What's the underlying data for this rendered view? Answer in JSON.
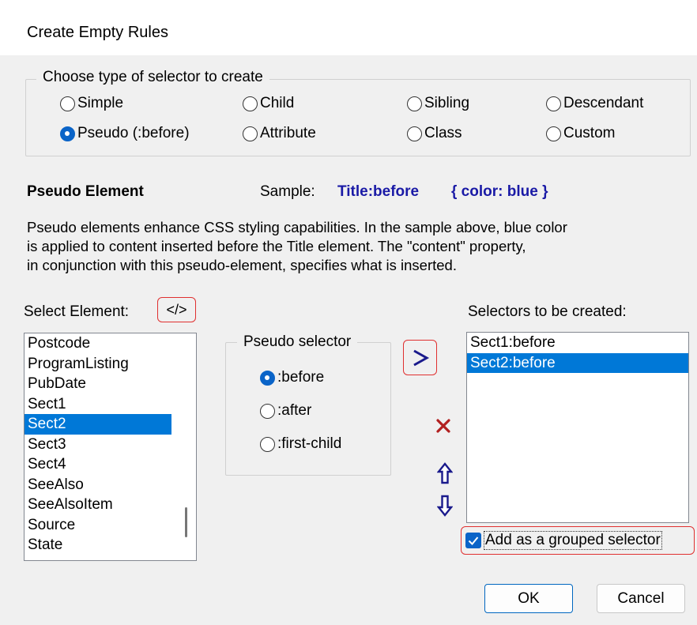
{
  "window": {
    "title": "Create Empty Rules"
  },
  "selector_type": {
    "legend": "Choose type of selector to create",
    "options": [
      {
        "label": "Simple",
        "checked": false
      },
      {
        "label": "Child",
        "checked": false
      },
      {
        "label": "Sibling",
        "checked": false
      },
      {
        "label": "Descendant",
        "checked": false
      },
      {
        "label": "Pseudo (:before)",
        "checked": true
      },
      {
        "label": "Attribute",
        "checked": false
      },
      {
        "label": "Class",
        "checked": false
      },
      {
        "label": "Custom",
        "checked": false
      }
    ]
  },
  "info": {
    "heading": "Pseudo Element",
    "sample_label": "Sample:",
    "sample_selector": "Title:before",
    "sample_rule": "{ color: blue }",
    "description_lines": [
      "Pseudo elements enhance CSS styling capabilities. In the sample above, blue color",
      "is applied to content inserted before the Title element. The \"content\" property,",
      "in conjunction with this pseudo-element, specifies what is inserted."
    ]
  },
  "element_list": {
    "label": "Select Element:",
    "tag_icon_text": "</>",
    "items": [
      "Postcode",
      "ProgramListing",
      "PubDate",
      "Sect1",
      "Sect2",
      "Sect3",
      "Sect4",
      "SeeAlso",
      "SeeAlsoItem",
      "Source",
      "State"
    ],
    "selected": "Sect2"
  },
  "pseudo_selector": {
    "legend": "Pseudo selector",
    "options": [
      {
        "label": ":before",
        "checked": true
      },
      {
        "label": ":after",
        "checked": false
      },
      {
        "label": ":first-child",
        "checked": false
      }
    ]
  },
  "selectors_list": {
    "label": "Selectors to be created:",
    "items": [
      "Sect1:before",
      "Sect2:before"
    ],
    "selected": "Sect2:before"
  },
  "grouped": {
    "label": "Add as a grouped selector",
    "checked": true
  },
  "buttons": {
    "ok": "OK",
    "cancel": "Cancel"
  },
  "colors": {
    "accent": "#0078d7",
    "highlight_border": "#e03030",
    "sample_text": "#1a1aa6",
    "delete_icon": "#b22020"
  },
  "icons": {
    "add": "chevron-right-icon",
    "delete": "delete-x-icon",
    "up": "arrow-up-icon",
    "down": "arrow-down-icon",
    "tag": "code-tag-icon"
  }
}
